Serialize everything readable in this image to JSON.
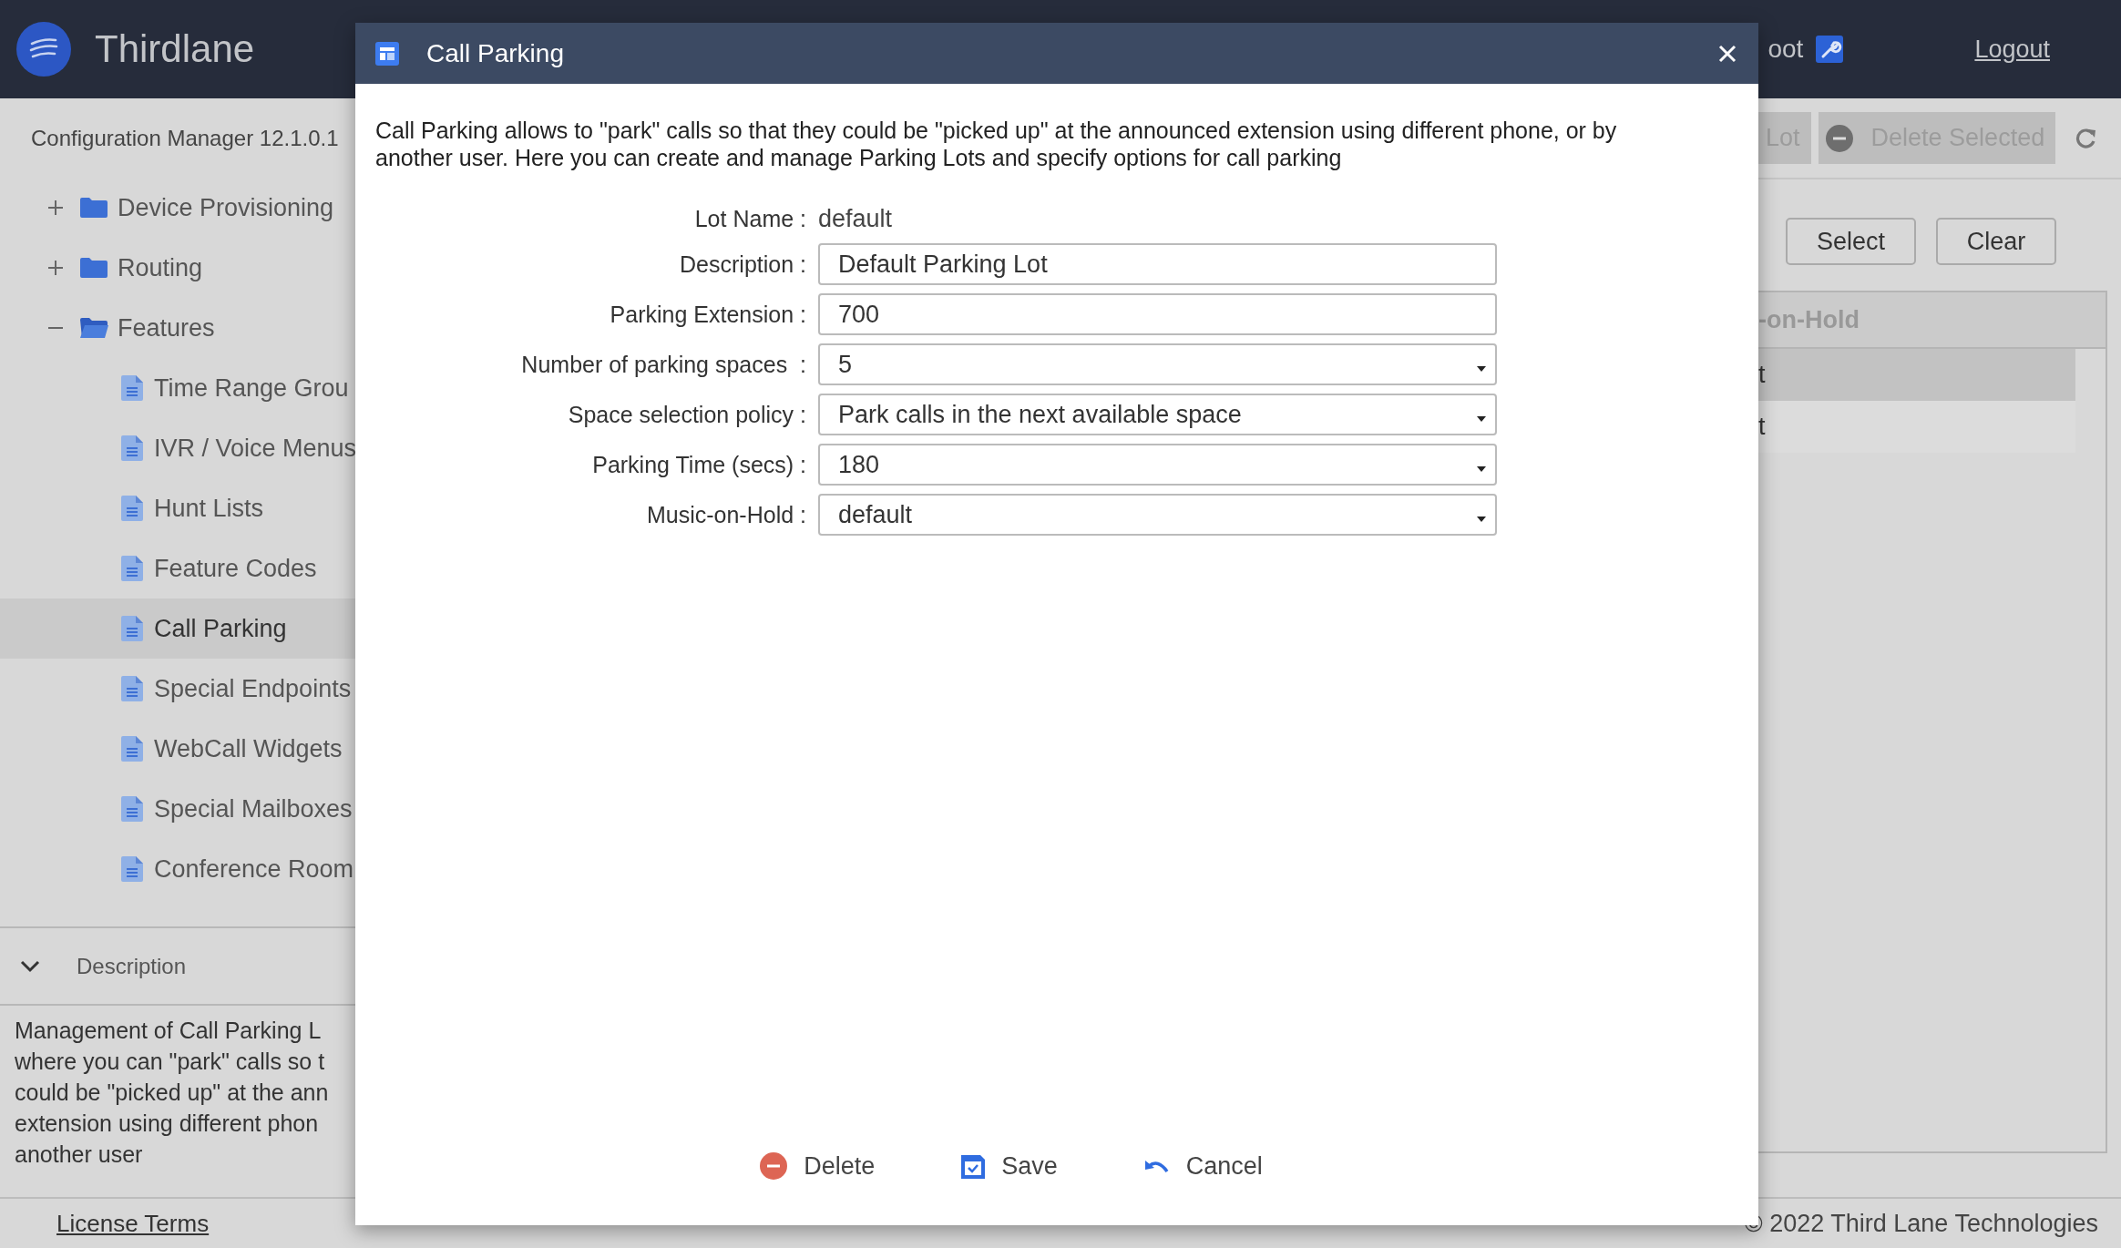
{
  "header": {
    "app_name": "Thirdlane",
    "user": "oot",
    "logout": "Logout"
  },
  "sidebar": {
    "title": "Configuration Manager 12.1.0.1",
    "tree": [
      {
        "label": "Device Provisioning",
        "kind": "folder",
        "expanded": false,
        "selected": false
      },
      {
        "label": "Routing",
        "kind": "folder",
        "expanded": false,
        "selected": false
      },
      {
        "label": "Features",
        "kind": "folder",
        "expanded": true,
        "selected": false,
        "children": [
          {
            "label": "Time Range Grou",
            "kind": "page",
            "selected": false
          },
          {
            "label": "IVR / Voice Menus",
            "kind": "page",
            "selected": false
          },
          {
            "label": "Hunt Lists",
            "kind": "page",
            "selected": false
          },
          {
            "label": "Feature Codes",
            "kind": "page",
            "selected": false
          },
          {
            "label": "Call Parking",
            "kind": "page",
            "selected": true
          },
          {
            "label": "Special Endpoints",
            "kind": "page",
            "selected": false
          },
          {
            "label": "WebCall Widgets",
            "kind": "page",
            "selected": false
          },
          {
            "label": "Special Mailboxes",
            "kind": "page",
            "selected": false
          },
          {
            "label": "Conference Room",
            "kind": "page",
            "selected": false
          }
        ]
      }
    ],
    "description": {
      "title": "Description",
      "expanded": true,
      "text": "Management of Call Parking L\nwhere you can \"park\" calls so t\ncould be \"picked up\" at the ann\nextension using different phon\nanother user"
    }
  },
  "toolbar": {
    "buttons": [
      {
        "label": "Lot",
        "kind": "plain"
      },
      {
        "label": "Delete Selected",
        "kind": "delete"
      }
    ]
  },
  "filter_buttons": [
    "Select",
    "Clear"
  ],
  "table": {
    "columns": [
      "-on-Hold"
    ],
    "rows": [
      {
        "cells": [
          "t"
        ],
        "selected": true
      },
      {
        "cells": [
          "t"
        ],
        "selected": false
      }
    ]
  },
  "footer": {
    "link": "License Terms",
    "copyright": "© 2022 Third Lane Technologies"
  },
  "dialog": {
    "title": "Call Parking",
    "intro": "Call Parking allows to \"park\" calls so that they could be \"picked up\" at the announced extension using different phone, or by another user. Here you can create and manage Parking Lots and specify options for call parking",
    "fields": [
      {
        "label": "Lot Name :",
        "kind": "static",
        "value": "default"
      },
      {
        "label": "Description :",
        "kind": "text",
        "value": "Default Parking Lot"
      },
      {
        "label": "Parking Extension :",
        "kind": "text",
        "value": "700"
      },
      {
        "label": "Number of parking spaces  :",
        "kind": "select",
        "value": "5"
      },
      {
        "label": "Space selection policy :",
        "kind": "select",
        "value": "Park calls in the next available space"
      },
      {
        "label": "Parking Time (secs) :",
        "kind": "select",
        "value": "180"
      },
      {
        "label": "Music-on-Hold :",
        "kind": "select",
        "value": "default"
      }
    ],
    "buttons": [
      {
        "label": "Delete",
        "kind": "delete"
      },
      {
        "label": "Save",
        "kind": "save"
      },
      {
        "label": "Cancel",
        "kind": "cancel"
      }
    ]
  }
}
